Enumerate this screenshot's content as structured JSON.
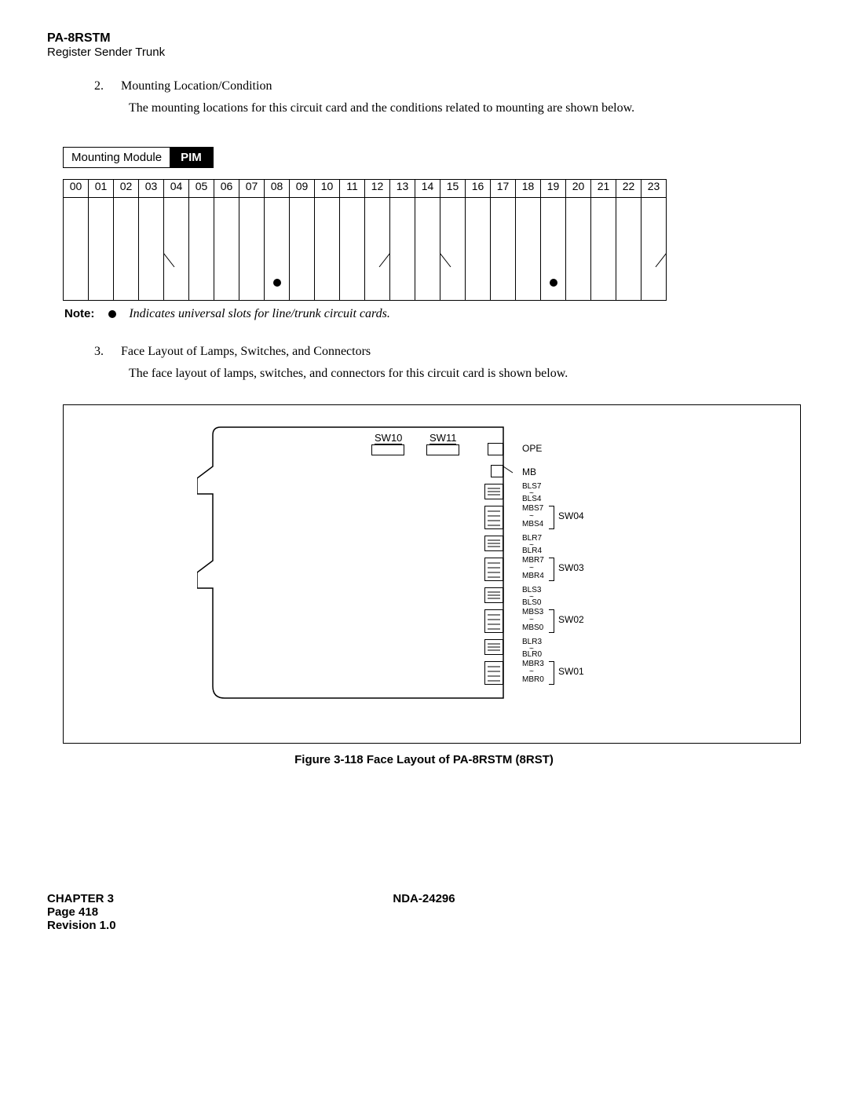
{
  "header": {
    "title": "PA-8RSTM",
    "subtitle": "Register Sender Trunk"
  },
  "section2": {
    "num": "2.",
    "title": "Mounting Location/Condition",
    "body": "The mounting locations for this circuit card and the conditions related to mounting are shown below."
  },
  "mounting": {
    "label": "Mounting Module",
    "pim": "PIM"
  },
  "slots": [
    "00",
    "01",
    "02",
    "03",
    "04",
    "05",
    "06",
    "07",
    "08",
    "09",
    "10",
    "11",
    "12",
    "13",
    "14",
    "15",
    "16",
    "17",
    "18",
    "19",
    "20",
    "21",
    "22",
    "23"
  ],
  "dot_slots": [
    8,
    19
  ],
  "note": {
    "label": "Note:",
    "text": "Indicates universal slots for line/trunk circuit cards."
  },
  "section3": {
    "num": "3.",
    "title": "Face Layout of Lamps, Switches, and Connectors",
    "body": "The face layout of lamps, switches, and connectors for this circuit card is shown below."
  },
  "figure": {
    "sw10": "SW10",
    "sw11": "SW11",
    "ope": "OPE",
    "mb": "MB",
    "bls7": "BLS7",
    "bls4": "BLS4",
    "mbs7": "MBS7",
    "mbs4": "MBS4",
    "sw04": "SW04",
    "blr7": "BLR7",
    "blr4": "BLR4",
    "mbr7": "MBR7",
    "mbr4": "MBR4",
    "sw03": "SW03",
    "bls3": "BLS3",
    "bls0": "BLS0",
    "mbs3": "MBS3",
    "mbs0": "MBS0",
    "sw02": "SW02",
    "blr3": "BLR3",
    "blr0": "BLR0",
    "mbr3": "MBR3",
    "mbr0": "MBR0",
    "sw01": "SW01",
    "tilde": "~",
    "caption": "Figure 3-118   Face Layout of PA-8RSTM (8RST)"
  },
  "footer": {
    "chapter": "CHAPTER 3",
    "doc": "NDA-24296",
    "page": "Page 418",
    "rev": "Revision 1.0"
  }
}
